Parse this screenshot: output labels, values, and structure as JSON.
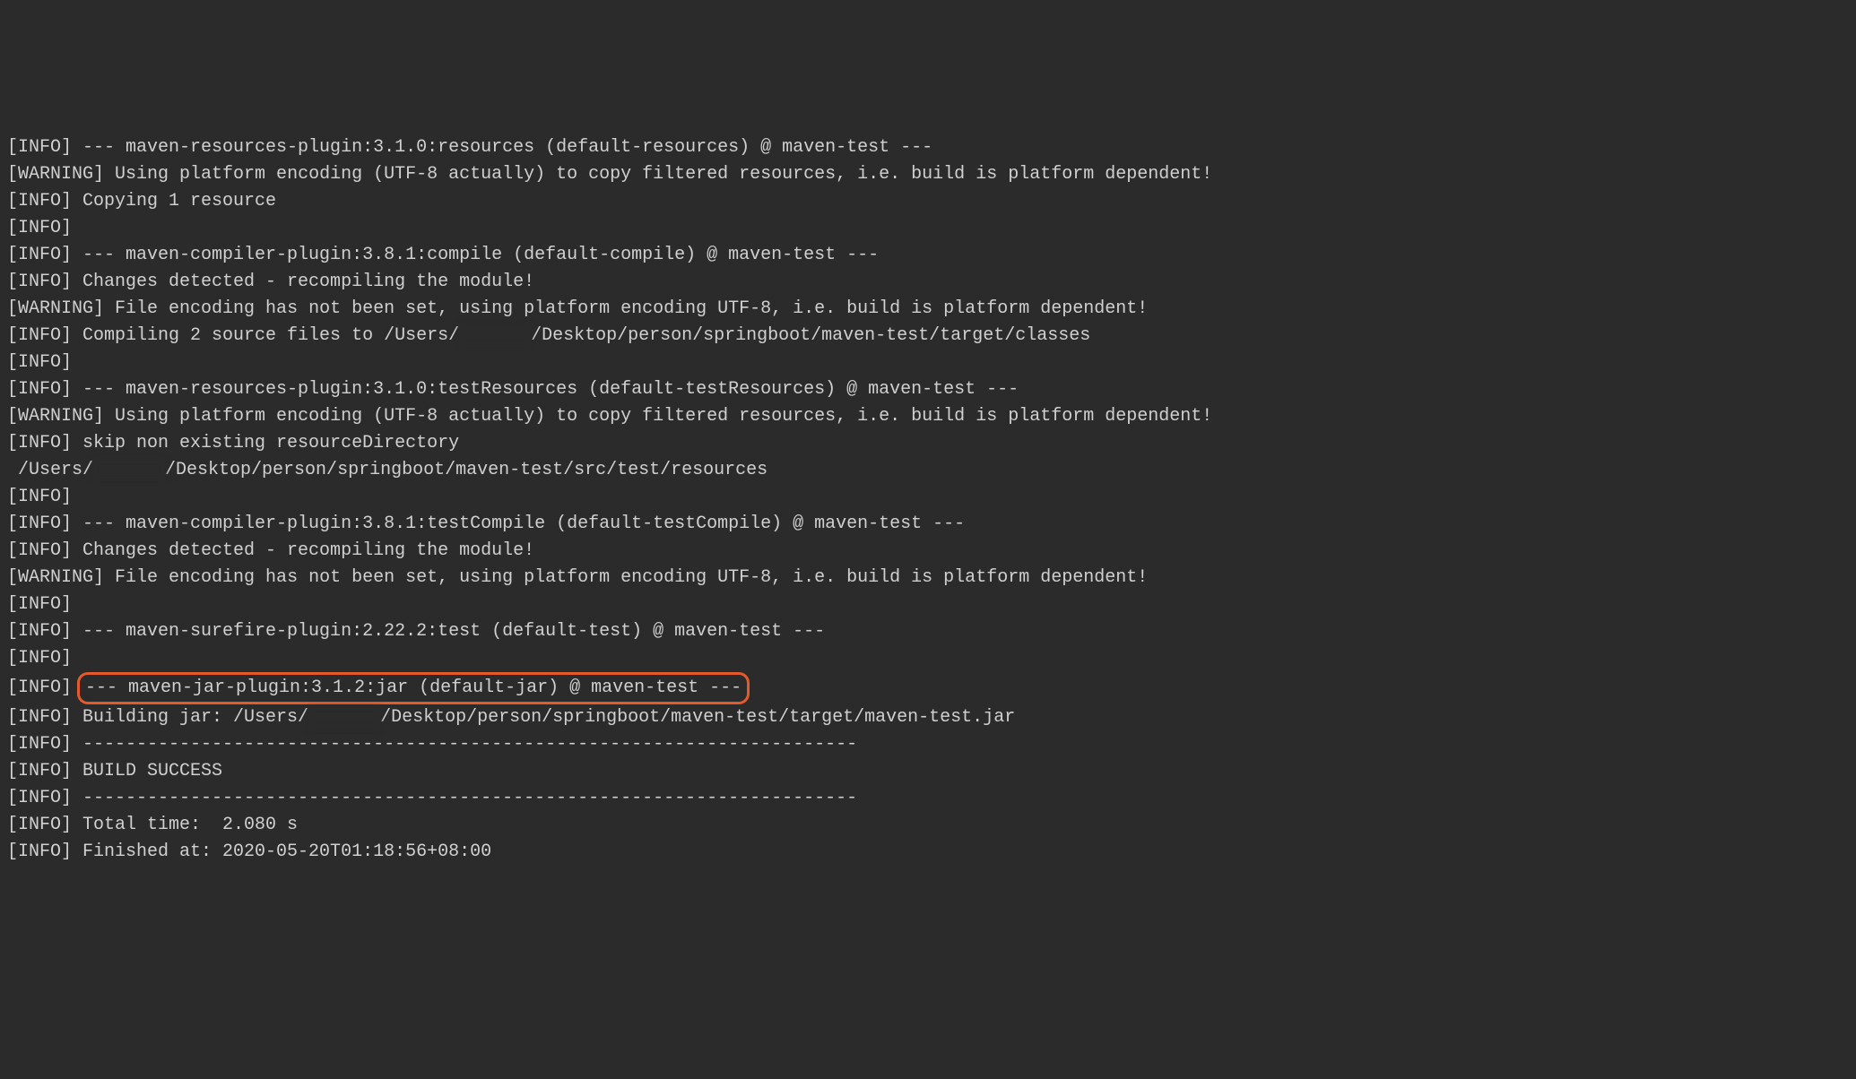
{
  "lines": [
    {
      "level": "INFO",
      "text": "--- maven-resources-plugin:3.1.0:resources (default-resources) @ maven-test ---"
    },
    {
      "level": "WARNING",
      "text": "Using platform encoding (UTF-8 actually) to copy filtered resources, i.e. build is platform dependent!"
    },
    {
      "level": "INFO",
      "text": "Copying 1 resource"
    },
    {
      "level": "INFO",
      "text": ""
    },
    {
      "level": "INFO",
      "text": "--- maven-compiler-plugin:3.8.1:compile (default-compile) @ maven-test ---"
    },
    {
      "level": "INFO",
      "text": "Changes detected - recompiling the module!"
    },
    {
      "level": "WARNING",
      "text": "File encoding has not been set, using platform encoding UTF-8, i.e. build is platform dependent!"
    },
    {
      "level": "INFO",
      "text": "Compiling 2 source files to /Users/",
      "redact": "xxxxxx",
      "tail": "/Desktop/person/springboot/maven-test/target/classes"
    },
    {
      "level": "INFO",
      "text": ""
    },
    {
      "level": "INFO",
      "text": "--- maven-resources-plugin:3.1.0:testResources (default-testResources) @ maven-test ---"
    },
    {
      "level": "WARNING",
      "text": "Using platform encoding (UTF-8 actually) to copy filtered resources, i.e. build is platform dependent!"
    },
    {
      "level": "INFO",
      "text": "skip non existing resourceDirectory"
    },
    {
      "level": null,
      "text": " /Users/",
      "redact": "xxxxxx",
      "tail": "/Desktop/person/springboot/maven-test/src/test/resources"
    },
    {
      "level": "INFO",
      "text": ""
    },
    {
      "level": "INFO",
      "text": "--- maven-compiler-plugin:3.8.1:testCompile (default-testCompile) @ maven-test ---"
    },
    {
      "level": "INFO",
      "text": "Changes detected - recompiling the module!"
    },
    {
      "level": "WARNING",
      "text": "File encoding has not been set, using platform encoding UTF-8, i.e. build is platform dependent!"
    },
    {
      "level": "INFO",
      "text": ""
    },
    {
      "level": "INFO",
      "text": "--- maven-surefire-plugin:2.22.2:test (default-test) @ maven-test ---"
    },
    {
      "level": "INFO",
      "text": ""
    },
    {
      "level": "INFO",
      "highlight": true,
      "text": "--- maven-jar-plugin:3.1.2:jar (default-jar) @ maven-test ---"
    },
    {
      "level": "INFO",
      "text": "Building jar: /Users/",
      "redact": "xxxxxx",
      "tail": "/Desktop/person/springboot/maven-test/target/maven-test.jar"
    },
    {
      "level": "INFO",
      "text": "------------------------------------------------------------------------"
    },
    {
      "level": "INFO",
      "text": "BUILD SUCCESS"
    },
    {
      "level": "INFO",
      "text": "------------------------------------------------------------------------"
    },
    {
      "level": "INFO",
      "text": "Total time:  2.080 s"
    },
    {
      "level": "INFO",
      "text": "Finished at: 2020-05-20T01:18:56+08:00"
    }
  ]
}
